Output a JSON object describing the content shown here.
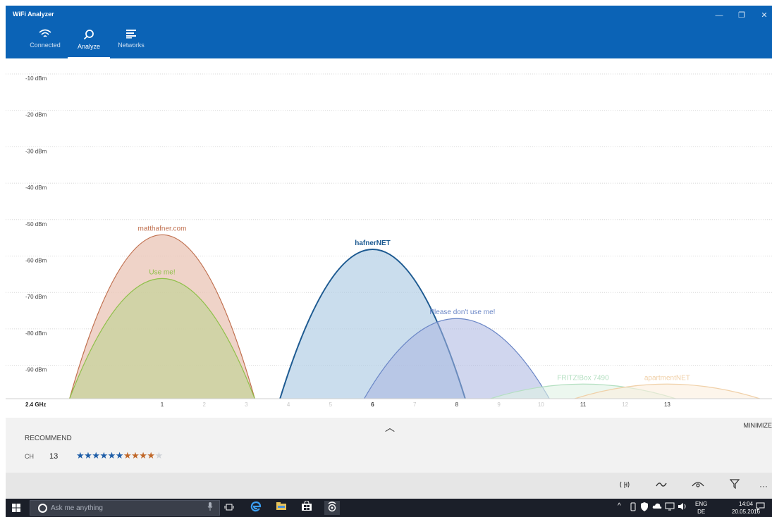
{
  "window": {
    "title": "WiFi Analyzer",
    "minimize": "—",
    "restore": "❐",
    "close": "✕"
  },
  "nav": {
    "tabs": [
      {
        "label": "Connected",
        "icon": "wifi-icon"
      },
      {
        "label": "Analyze",
        "icon": "search-icon"
      },
      {
        "label": "Networks",
        "icon": "list-icon"
      }
    ],
    "active_tab": "Analyze"
  },
  "chart_data": {
    "type": "area",
    "band_label": "2.4 GHz",
    "ylim": [
      -100,
      -5
    ],
    "y_unit": "dBm",
    "y_ticks": [
      "-10 dBm",
      "-20 dBm",
      "-30 dBm",
      "-40 dBm",
      "-50 dBm",
      "-60 dBm",
      "-70 dBm",
      "-80 dBm",
      "-90 dBm"
    ],
    "x_ticks": [
      "1",
      "2",
      "3",
      "4",
      "5",
      "6",
      "7",
      "8",
      "9",
      "10",
      "11",
      "12",
      "13"
    ],
    "x_ticks_emphasized": [
      "1",
      "6",
      "8",
      "11",
      "13"
    ],
    "x_tick_bold": "6",
    "series": [
      {
        "name": "matthafner.com",
        "channel": 1,
        "signal_dbm": -53,
        "color": "#c0704f",
        "fill": "#e9c4b5",
        "opacity": 0.75,
        "bold": false
      },
      {
        "name": "Use me!",
        "channel": 1,
        "signal_dbm": -65,
        "color": "#8fc04a",
        "fill": "#c4d398",
        "opacity": 0.7,
        "bold": false
      },
      {
        "name": "hafnerNET",
        "channel": 6,
        "signal_dbm": -57,
        "color": "#1d5a91",
        "fill": "#aecbe4",
        "opacity": 0.65,
        "bold": true
      },
      {
        "name": "Please don't use me!",
        "channel": 8,
        "signal_dbm": -76,
        "color": "#6a86c6",
        "fill": "#a9b5e0",
        "opacity": 0.55,
        "bold": false
      },
      {
        "name": "FRITZ!Box 7490",
        "channel": 11,
        "signal_dbm": -94,
        "color": "#b3dfc0",
        "fill": "#dff2e4",
        "opacity": 0.6,
        "bold": false
      },
      {
        "name": "apartmentNET",
        "channel": 13,
        "signal_dbm": -94,
        "color": "#f0d0a8",
        "fill": "#fbeedd",
        "opacity": 0.6,
        "bold": false
      }
    ]
  },
  "recommend": {
    "title": "RECOMMEND",
    "ch_label": "CH",
    "ch_value": "13",
    "rating_blue": 6,
    "rating_orange": 4,
    "rating_grey": 1,
    "star_char": "★",
    "colors": {
      "blue": "#1f5ea8",
      "orange": "#c0682a",
      "grey": "#cfd3d8"
    }
  },
  "panel": {
    "collapse_icon": "︿",
    "minimize_label": "MINIMIZE"
  },
  "commands": [
    "antenna-icon",
    "wave-icon",
    "eye-icon",
    "filter-icon",
    "more-icon"
  ],
  "taskbar": {
    "search_placeholder": "Ask me anything",
    "lang_top": "ENG",
    "lang_bottom": "DE",
    "time": "14:04",
    "date": "20.05.2016"
  }
}
